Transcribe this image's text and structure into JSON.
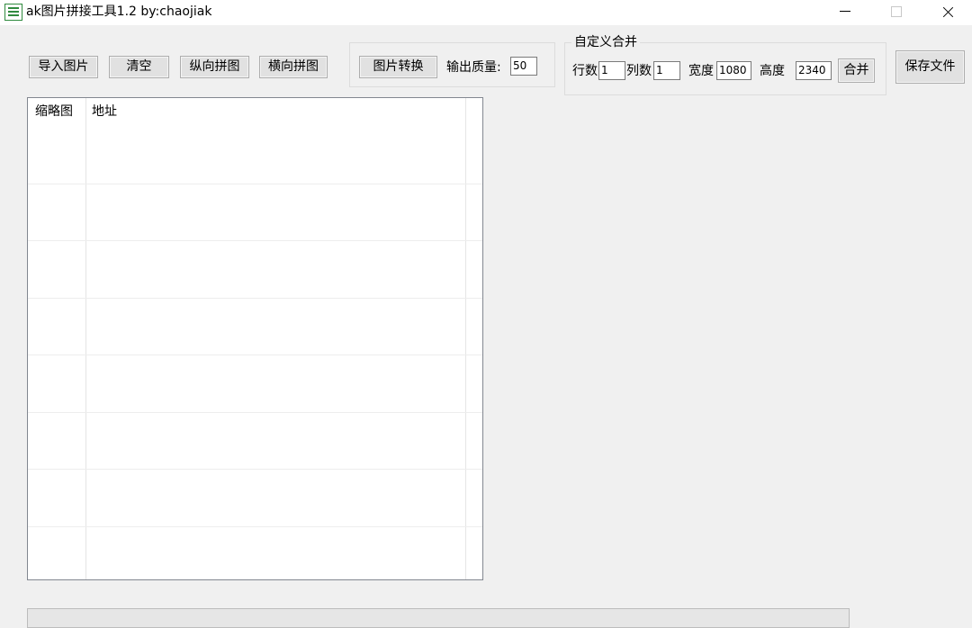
{
  "window": {
    "title": "ak图片拼接工具1.2  by:chaojiak"
  },
  "toolbar": {
    "import_label": "导入图片",
    "clear_label": "清空",
    "vertical_label": "纵向拼图",
    "horizontal_label": "横向拼图",
    "convert_label": "图片转换",
    "quality_label": "输出质量:",
    "quality_value": "50"
  },
  "custom_merge": {
    "title": "自定义合并",
    "rows_label": "行数",
    "rows_value": "1",
    "cols_label": "列数",
    "cols_value": "1",
    "width_label": "宽度",
    "width_value": "1080",
    "height_label": "高度",
    "height_value": "2340",
    "merge_label": "合并"
  },
  "save_label": "保存文件",
  "list": {
    "columns": [
      "缩略图",
      "地址"
    ]
  },
  "progress": {
    "value": 0
  },
  "icons": {
    "app": "app-icon",
    "minimize": "minimize-icon",
    "maximize": "maximize-icon",
    "close": "close-icon"
  }
}
